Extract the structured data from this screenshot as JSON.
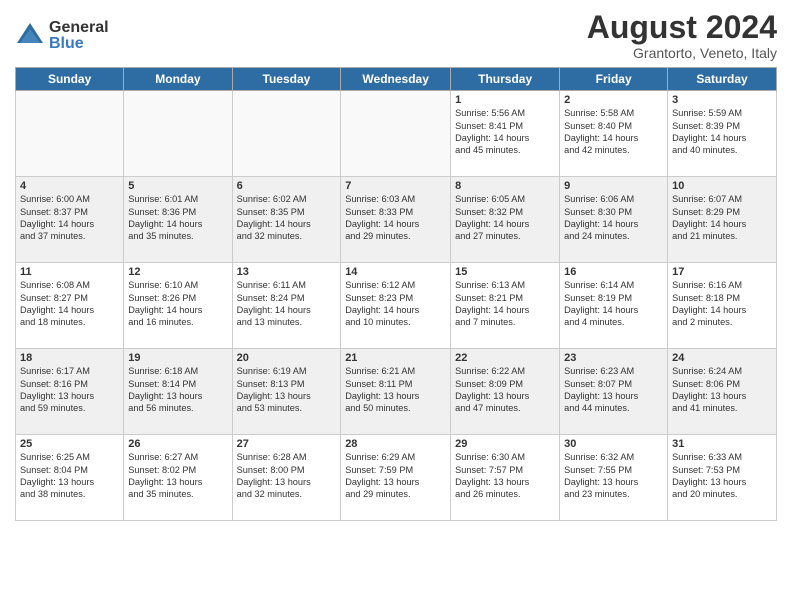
{
  "header": {
    "logo_general": "General",
    "logo_blue": "Blue",
    "month_title": "August 2024",
    "subtitle": "Grantorto, Veneto, Italy"
  },
  "days_of_week": [
    "Sunday",
    "Monday",
    "Tuesday",
    "Wednesday",
    "Thursday",
    "Friday",
    "Saturday"
  ],
  "weeks": [
    [
      {
        "day": "",
        "info": ""
      },
      {
        "day": "",
        "info": ""
      },
      {
        "day": "",
        "info": ""
      },
      {
        "day": "",
        "info": ""
      },
      {
        "day": "1",
        "info": "Sunrise: 5:56 AM\nSunset: 8:41 PM\nDaylight: 14 hours\nand 45 minutes."
      },
      {
        "day": "2",
        "info": "Sunrise: 5:58 AM\nSunset: 8:40 PM\nDaylight: 14 hours\nand 42 minutes."
      },
      {
        "day": "3",
        "info": "Sunrise: 5:59 AM\nSunset: 8:39 PM\nDaylight: 14 hours\nand 40 minutes."
      }
    ],
    [
      {
        "day": "4",
        "info": "Sunrise: 6:00 AM\nSunset: 8:37 PM\nDaylight: 14 hours\nand 37 minutes."
      },
      {
        "day": "5",
        "info": "Sunrise: 6:01 AM\nSunset: 8:36 PM\nDaylight: 14 hours\nand 35 minutes."
      },
      {
        "day": "6",
        "info": "Sunrise: 6:02 AM\nSunset: 8:35 PM\nDaylight: 14 hours\nand 32 minutes."
      },
      {
        "day": "7",
        "info": "Sunrise: 6:03 AM\nSunset: 8:33 PM\nDaylight: 14 hours\nand 29 minutes."
      },
      {
        "day": "8",
        "info": "Sunrise: 6:05 AM\nSunset: 8:32 PM\nDaylight: 14 hours\nand 27 minutes."
      },
      {
        "day": "9",
        "info": "Sunrise: 6:06 AM\nSunset: 8:30 PM\nDaylight: 14 hours\nand 24 minutes."
      },
      {
        "day": "10",
        "info": "Sunrise: 6:07 AM\nSunset: 8:29 PM\nDaylight: 14 hours\nand 21 minutes."
      }
    ],
    [
      {
        "day": "11",
        "info": "Sunrise: 6:08 AM\nSunset: 8:27 PM\nDaylight: 14 hours\nand 18 minutes."
      },
      {
        "day": "12",
        "info": "Sunrise: 6:10 AM\nSunset: 8:26 PM\nDaylight: 14 hours\nand 16 minutes."
      },
      {
        "day": "13",
        "info": "Sunrise: 6:11 AM\nSunset: 8:24 PM\nDaylight: 14 hours\nand 13 minutes."
      },
      {
        "day": "14",
        "info": "Sunrise: 6:12 AM\nSunset: 8:23 PM\nDaylight: 14 hours\nand 10 minutes."
      },
      {
        "day": "15",
        "info": "Sunrise: 6:13 AM\nSunset: 8:21 PM\nDaylight: 14 hours\nand 7 minutes."
      },
      {
        "day": "16",
        "info": "Sunrise: 6:14 AM\nSunset: 8:19 PM\nDaylight: 14 hours\nand 4 minutes."
      },
      {
        "day": "17",
        "info": "Sunrise: 6:16 AM\nSunset: 8:18 PM\nDaylight: 14 hours\nand 2 minutes."
      }
    ],
    [
      {
        "day": "18",
        "info": "Sunrise: 6:17 AM\nSunset: 8:16 PM\nDaylight: 13 hours\nand 59 minutes."
      },
      {
        "day": "19",
        "info": "Sunrise: 6:18 AM\nSunset: 8:14 PM\nDaylight: 13 hours\nand 56 minutes."
      },
      {
        "day": "20",
        "info": "Sunrise: 6:19 AM\nSunset: 8:13 PM\nDaylight: 13 hours\nand 53 minutes."
      },
      {
        "day": "21",
        "info": "Sunrise: 6:21 AM\nSunset: 8:11 PM\nDaylight: 13 hours\nand 50 minutes."
      },
      {
        "day": "22",
        "info": "Sunrise: 6:22 AM\nSunset: 8:09 PM\nDaylight: 13 hours\nand 47 minutes."
      },
      {
        "day": "23",
        "info": "Sunrise: 6:23 AM\nSunset: 8:07 PM\nDaylight: 13 hours\nand 44 minutes."
      },
      {
        "day": "24",
        "info": "Sunrise: 6:24 AM\nSunset: 8:06 PM\nDaylight: 13 hours\nand 41 minutes."
      }
    ],
    [
      {
        "day": "25",
        "info": "Sunrise: 6:25 AM\nSunset: 8:04 PM\nDaylight: 13 hours\nand 38 minutes."
      },
      {
        "day": "26",
        "info": "Sunrise: 6:27 AM\nSunset: 8:02 PM\nDaylight: 13 hours\nand 35 minutes."
      },
      {
        "day": "27",
        "info": "Sunrise: 6:28 AM\nSunset: 8:00 PM\nDaylight: 13 hours\nand 32 minutes."
      },
      {
        "day": "28",
        "info": "Sunrise: 6:29 AM\nSunset: 7:59 PM\nDaylight: 13 hours\nand 29 minutes."
      },
      {
        "day": "29",
        "info": "Sunrise: 6:30 AM\nSunset: 7:57 PM\nDaylight: 13 hours\nand 26 minutes."
      },
      {
        "day": "30",
        "info": "Sunrise: 6:32 AM\nSunset: 7:55 PM\nDaylight: 13 hours\nand 23 minutes."
      },
      {
        "day": "31",
        "info": "Sunrise: 6:33 AM\nSunset: 7:53 PM\nDaylight: 13 hours\nand 20 minutes."
      }
    ]
  ]
}
